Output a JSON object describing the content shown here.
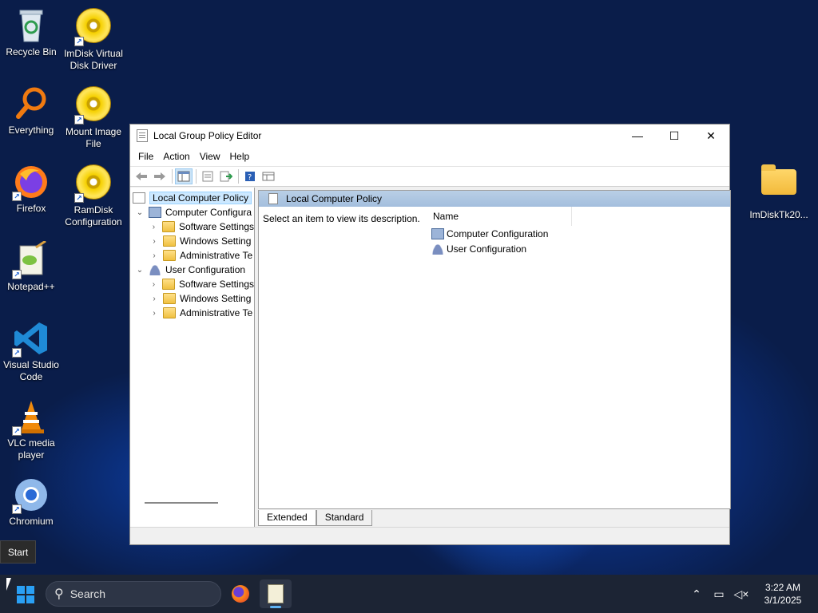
{
  "desktop": {
    "icons": [
      {
        "label": "Recycle Bin",
        "icon": "recycle-bin-icon"
      },
      {
        "label": "ImDisk Virtual Disk Driver",
        "icon": "disc-icon"
      },
      {
        "label": "Everything",
        "icon": "magnifier-icon"
      },
      {
        "label": "Mount Image File",
        "icon": "disc-icon"
      },
      {
        "label": "Firefox",
        "icon": "firefox-icon"
      },
      {
        "label": "RamDisk Configuration",
        "icon": "disc-icon"
      },
      {
        "label": "Notepad++",
        "icon": "notepadpp-icon"
      },
      {
        "label": "Visual Studio Code",
        "icon": "vscode-icon"
      },
      {
        "label": "VLC media player",
        "icon": "vlc-cone-icon"
      },
      {
        "label": "Chromium",
        "icon": "chromium-icon"
      },
      {
        "label": "ImDiskTk20...",
        "icon": "folder-icon"
      }
    ]
  },
  "window": {
    "title": "Local Group Policy Editor",
    "controls": {
      "minimize": "—",
      "maximize": "☐",
      "close": "✕"
    },
    "menu": [
      "File",
      "Action",
      "View",
      "Help"
    ],
    "tree": {
      "root": "Local Computer Policy",
      "computer": "Computer Configura",
      "computer_children": [
        "Software Settings",
        "Windows Setting",
        "Administrative Te"
      ],
      "user": "User Configuration",
      "user_children": [
        "Software Settings",
        "Windows Setting",
        "Administrative Te"
      ]
    },
    "right": {
      "header": "Local Computer Policy",
      "description": "Select an item to view its description.",
      "column_name": "Name",
      "items": [
        "Computer Configuration",
        "User Configuration"
      ]
    },
    "tabs": [
      "Extended",
      "Standard"
    ]
  },
  "tooltip": "Start",
  "taskbar": {
    "search_placeholder": "Search",
    "time": "3:22 AM",
    "date": "3/1/2025"
  },
  "colors": {
    "accent": "#2aa0f5",
    "taskbar": "#1c2434",
    "selection": "#cce8ff"
  }
}
